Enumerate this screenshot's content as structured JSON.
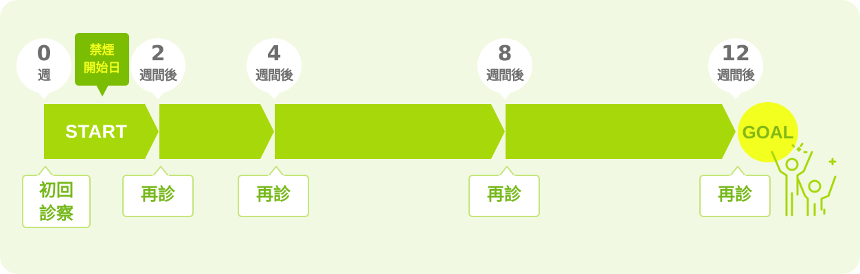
{
  "colors": {
    "panel_bg": "#f2f9e2",
    "arrow_green": "#a7d80a",
    "tag_green": "#7bbd02",
    "highlight_yellow": "#f3ff1e",
    "box_border": "#c6e57c",
    "text_green": "#77b81c",
    "text_gray": "#6e6e6e"
  },
  "milestones": [
    {
      "num": "0",
      "unit": "週"
    },
    {
      "num": "2",
      "unit": "週間後"
    },
    {
      "num": "4",
      "unit": "週間後"
    },
    {
      "num": "8",
      "unit": "週間後"
    },
    {
      "num": "12",
      "unit": "週間後"
    }
  ],
  "quit_tag": {
    "line1": "禁煙",
    "line2": "開始日"
  },
  "start_label": "START",
  "goal_label": "GOAL",
  "visits": {
    "first_line1": "初回",
    "first_line2": "診察",
    "revisit": "再診"
  },
  "icons": {
    "celebrate": "celebrating-people-icon"
  }
}
